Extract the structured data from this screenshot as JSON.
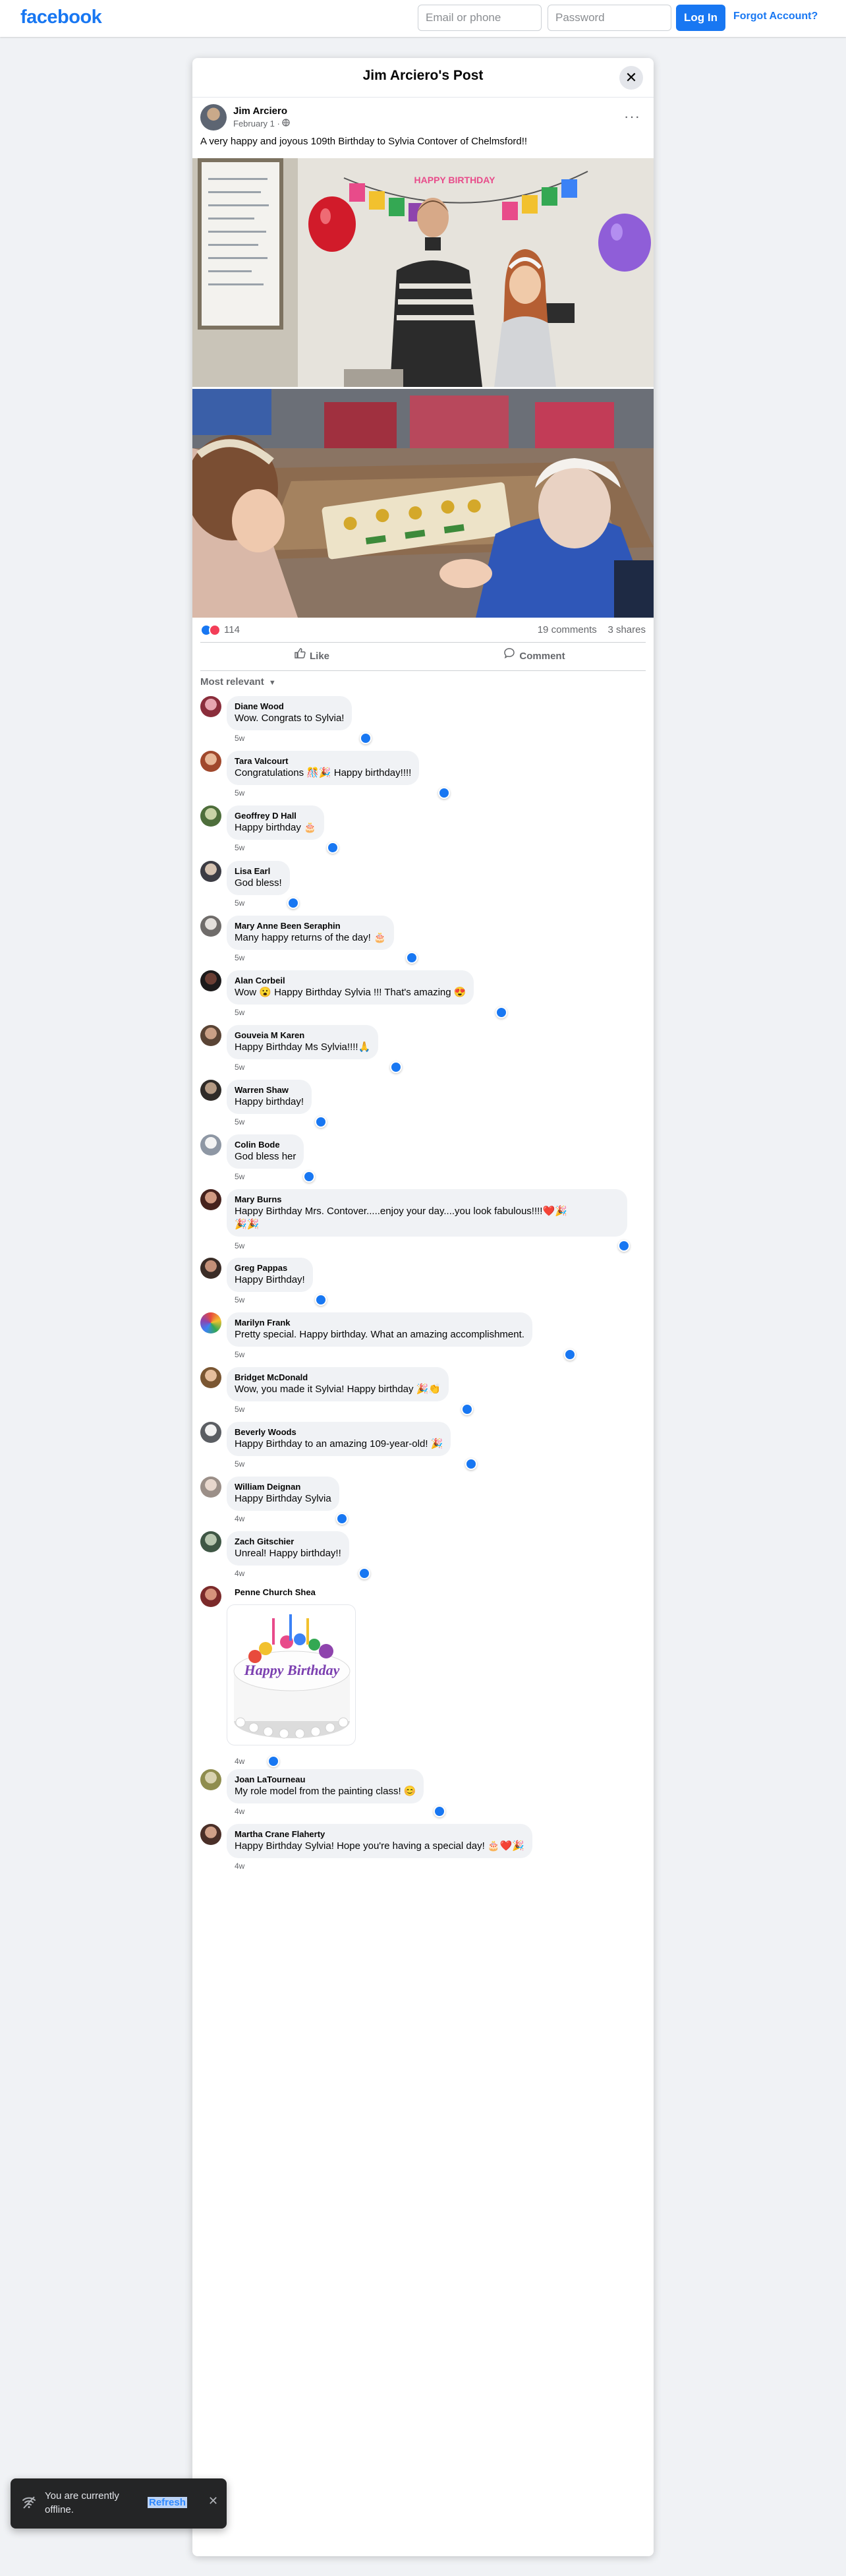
{
  "topbar": {
    "logo": "facebook",
    "email_placeholder": "Email or phone",
    "password_placeholder": "Password",
    "login_label": "Log In",
    "forgot_label": "Forgot Account?",
    "brand_color": "#1877f2"
  },
  "post": {
    "title": "Jim Arciero's Post",
    "close_icon": "close-icon",
    "author": "Jim Arciero",
    "date": "February 1",
    "privacy_icon": "globe-icon",
    "more_label": "···",
    "caption": "A very happy and joyous 109th Birthday to Sylvia Contover of Chelmsford!!",
    "banner_text": "HAPPY BIRTHDAY",
    "reaction_count": "114",
    "comments_count": "19 comments",
    "shares_count": "3 shares",
    "like_label": "Like",
    "comment_label": "Comment",
    "sort_label": "Most relevant"
  },
  "comments": [
    {
      "name": "Diane Wood",
      "text": "Wow. Congrats to Sylvia!",
      "time": "5w"
    },
    {
      "name": "Tara Valcourt",
      "text": "Congratulations 🎊🎉 Happy birthday!!!!",
      "time": "5w"
    },
    {
      "name": "Geoffrey D Hall",
      "text": "Happy birthday 🎂",
      "time": "5w"
    },
    {
      "name": "Lisa Earl",
      "text": "God bless!",
      "time": "5w"
    },
    {
      "name": "Mary Anne Been Seraphin",
      "text": "Many happy returns of the day! 🎂",
      "time": "5w"
    },
    {
      "name": "Alan Corbeil",
      "text": "Wow 😮 Happy Birthday Sylvia !!! That's amazing 😍",
      "time": "5w"
    },
    {
      "name": "Gouveia M Karen",
      "text": "Happy Birthday Ms Sylvia!!!!🙏",
      "time": "5w"
    },
    {
      "name": "Warren Shaw",
      "text": "Happy birthday!",
      "time": "5w"
    },
    {
      "name": "Colin Bode",
      "text": "God bless her",
      "time": "5w"
    },
    {
      "name": "Mary Burns",
      "text": "Happy Birthday Mrs. Contover.....enjoy your day....you look fabulous!!!!❤️🎉",
      "text2": "🎉🎉",
      "time": "5w"
    },
    {
      "name": "Greg Pappas",
      "text": "Happy Birthday!",
      "time": "5w"
    },
    {
      "name": "Marilyn Frank",
      "text": "Pretty special. Happy birthday. What an amazing accomplishment.",
      "time": "5w"
    },
    {
      "name": "Bridget McDonald",
      "text": "Wow, you made it Sylvia! Happy birthday 🎉👏",
      "time": "5w"
    },
    {
      "name": "Beverly Woods",
      "text": "Happy Birthday to an amazing 109-year-old! 🎉",
      "time": "5w"
    },
    {
      "name": "William Deignan",
      "text": "Happy Birthday Sylvia",
      "time": "4w"
    },
    {
      "name": "Zach Gitschier",
      "text": "Unreal! Happy birthday!!",
      "time": "4w"
    },
    {
      "name": "Penne Church Shea",
      "text": "",
      "sticker_text": "Happy Birthday",
      "time": "4w"
    },
    {
      "name": "Joan LaTourneau",
      "text": "My role model from the painting class! 😊",
      "time": "4w"
    },
    {
      "name": "Martha Crane Flaherty",
      "text": "Happy Birthday Sylvia! Hope you're having a special day! 🎂❤️🎉",
      "time": "4w"
    }
  ],
  "toast": {
    "text": "You are currently offline.",
    "action_label": "Refresh",
    "icon": "no-wifi-icon",
    "close_icon": "close-icon"
  }
}
